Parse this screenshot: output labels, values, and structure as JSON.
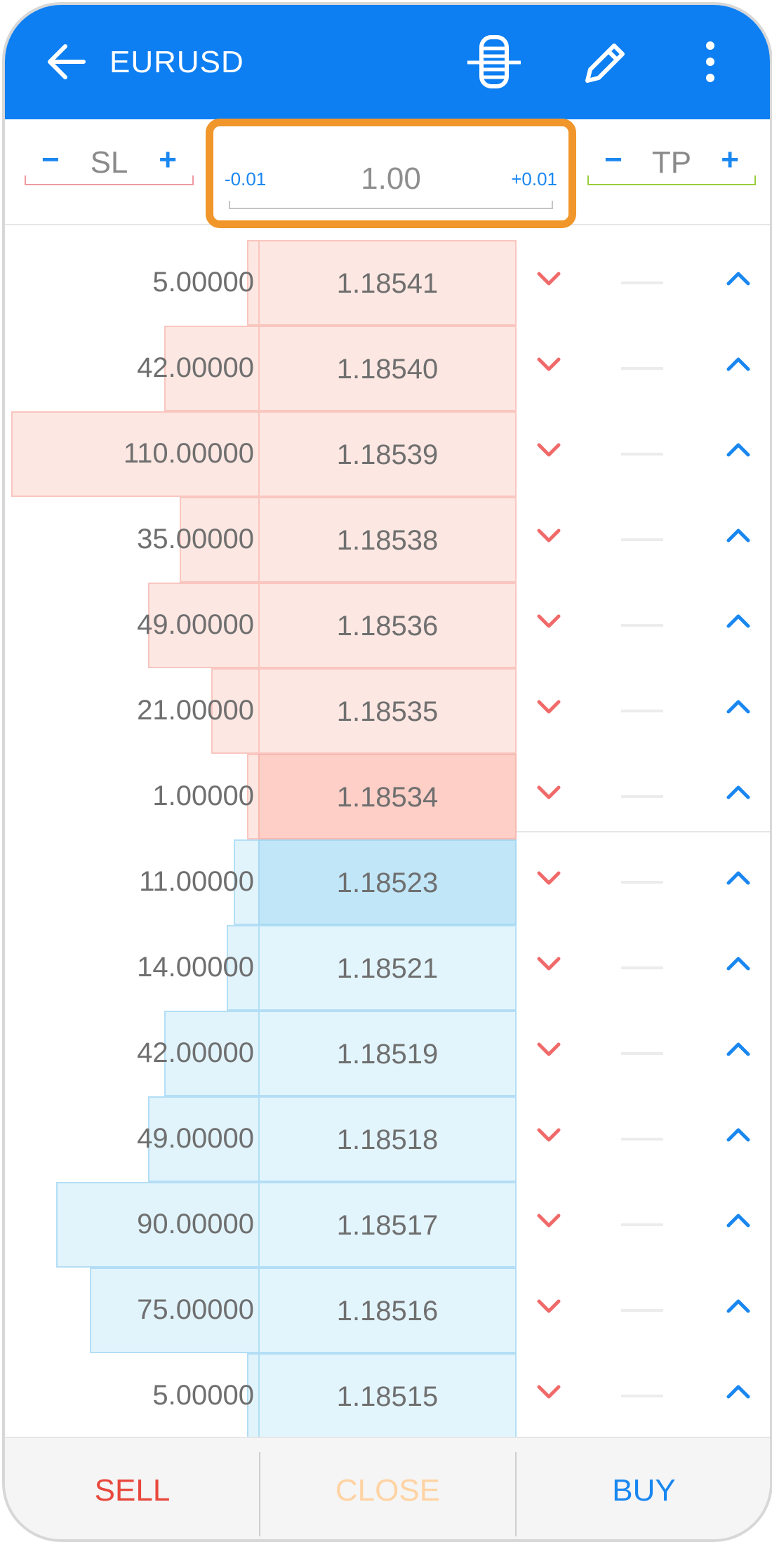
{
  "header": {
    "title": "EURUSD",
    "background": "#0d7ff2",
    "icons": [
      "back-arrow-icon",
      "depth-of-market-icon",
      "pencil-icon",
      "more-vertical-icon"
    ]
  },
  "controls": {
    "sl": {
      "minus": "−",
      "label": "SL",
      "plus": "+"
    },
    "tp": {
      "minus": "−",
      "label": "TP",
      "plus": "+"
    },
    "volume": {
      "minus": "-0.01",
      "value": "1.00",
      "plus": "+0.01"
    },
    "highlight_color": "#f0962a"
  },
  "book": {
    "rows": [
      {
        "side": "ask",
        "volume": "5.00000",
        "price": "1.18541"
      },
      {
        "side": "ask",
        "volume": "42.00000",
        "price": "1.18540"
      },
      {
        "side": "ask",
        "volume": "110.00000",
        "price": "1.18539"
      },
      {
        "side": "ask",
        "volume": "35.00000",
        "price": "1.18538"
      },
      {
        "side": "ask",
        "volume": "49.00000",
        "price": "1.18536"
      },
      {
        "side": "ask",
        "volume": "21.00000",
        "price": "1.18535"
      },
      {
        "side": "ask",
        "volume": "1.00000",
        "price": "1.18534",
        "best": true
      },
      {
        "side": "bid",
        "volume": "11.00000",
        "price": "1.18523",
        "best": true
      },
      {
        "side": "bid",
        "volume": "14.00000",
        "price": "1.18521"
      },
      {
        "side": "bid",
        "volume": "42.00000",
        "price": "1.18519"
      },
      {
        "side": "bid",
        "volume": "49.00000",
        "price": "1.18518"
      },
      {
        "side": "bid",
        "volume": "90.00000",
        "price": "1.18517"
      },
      {
        "side": "bid",
        "volume": "75.00000",
        "price": "1.18516"
      },
      {
        "side": "bid",
        "volume": "5.00000",
        "price": "1.18515"
      }
    ],
    "ask_color": "#fde7e2",
    "bid_color": "#e1f4fc",
    "sell_arrow_color": "#f06a6a",
    "buy_arrow_color": "#1a87f0"
  },
  "footer": {
    "sell": "SELL",
    "close": "CLOSE",
    "buy": "BUY",
    "sell_color": "#e8483c",
    "close_color": "#ffd3a3",
    "buy_color": "#1a87f0"
  }
}
